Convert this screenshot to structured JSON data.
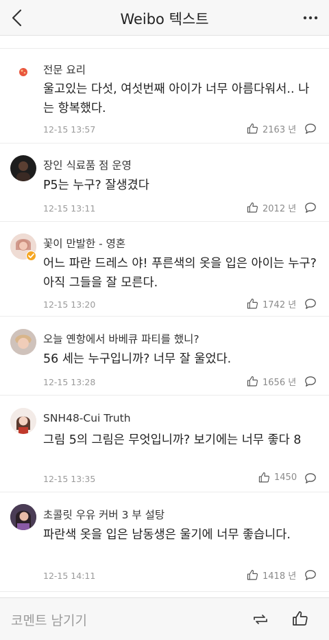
{
  "header": {
    "title": "Weibo 텍스트"
  },
  "comments": [
    {
      "user": "전문 요리",
      "text": "울고있는 다섯, 여섯번째 아이가 너무 아름다워서.. 나는 항복했다.",
      "time": "12-15 13:57",
      "likes": "2163 년"
    },
    {
      "user": "장인 식료품 점 운영",
      "text": "P5는 누구? 잘생겼다",
      "time": "12-15 13:11",
      "likes": "2012 년"
    },
    {
      "user": "꽃이 만발한 - 영혼",
      "text": "어느 파란 드레스 야! 푸른색의 옷을 입은 아이는 누구? 아직 그들을 잘 모른다.",
      "time": "12-15 13:20",
      "likes": "1742 년"
    },
    {
      "user": "오늘 옌항에서 바베큐 파티를 했니?",
      "text": "56 세는 누구입니까? 너무 잘 울었다.",
      "time": "12-15 13:28",
      "likes": "1656 년"
    },
    {
      "user": "SNH48-Cui Truth",
      "text": "그림 5의 그림은 무엇입니까? 보기에는 너무 좋다 8",
      "time": "12-15 13:35",
      "likes": "1450"
    },
    {
      "user": "초콜릿 우유 커버 3 부 설탕",
      "text": "파란색 옷을 입은 남동생은 울기에 너무 좋습니다.",
      "time": "12-15 14:11",
      "likes": "1418 년"
    }
  ],
  "footer": {
    "placeholder": "코멘트 남기기"
  },
  "colors": {
    "icon": "#555555",
    "accent_badge": "#f5a623",
    "muted": "#9a9a9a"
  }
}
